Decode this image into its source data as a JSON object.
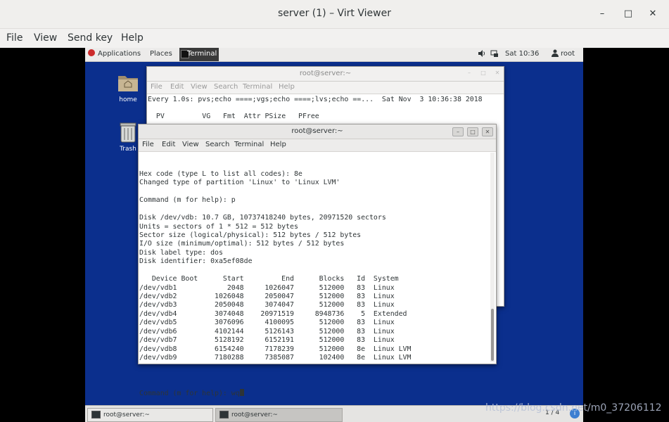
{
  "window": {
    "title": "server (1) – Virt Viewer",
    "minimize": "–",
    "maximize": "□",
    "close": "✕"
  },
  "menu": {
    "file": "File",
    "view": "View",
    "send_key": "Send key",
    "help": "Help"
  },
  "guest_topbar": {
    "applications": "Applications",
    "places": "Places",
    "terminal": "Terminal",
    "clock": "Sat 10:36",
    "user": "root"
  },
  "desktop": {
    "home": "home",
    "trash": "Trash"
  },
  "bg_terminal": {
    "title": "root@server:~",
    "menu": [
      "File",
      "Edit",
      "View",
      "Search",
      "Terminal",
      "Help"
    ],
    "line1": "Every 1.0s: pvs;echo ====;vgs;echo ====;lvs;echo ==...  Sat Nov  3 10:36:38 2018",
    "line2": "",
    "line3": "  PV         VG   Fmt  Attr PSize   PFree"
  },
  "fg_terminal": {
    "title": "root@server:~",
    "menu": [
      "File",
      "Edit",
      "View",
      "Search",
      "Terminal",
      "Help"
    ],
    "lines": [
      "Hex code (type L to list all codes): 8e",
      "Changed type of partition 'Linux' to 'Linux LVM'",
      "",
      "Command (m for help): p",
      "",
      "Disk /dev/vdb: 10.7 GB, 10737418240 bytes, 20971520 sectors",
      "Units = sectors of 1 * 512 = 512 bytes",
      "Sector size (logical/physical): 512 bytes / 512 bytes",
      "I/O size (minimum/optimal): 512 bytes / 512 bytes",
      "Disk label type: dos",
      "Disk identifier: 0xa5ef08de",
      "",
      "   Device Boot      Start         End      Blocks   Id  System",
      "/dev/vdb1            2048     1026047      512000   83  Linux",
      "/dev/vdb2         1026048     2050047      512000   83  Linux",
      "/dev/vdb3         2050048     3074047      512000   83  Linux",
      "/dev/vdb4         3074048    20971519     8948736    5  Extended",
      "/dev/vdb5         3076096     4100095      512000   83  Linux",
      "/dev/vdb6         4102144     5126143      512000   83  Linux",
      "/dev/vdb7         5128192     6152191      512000   83  Linux",
      "/dev/vdb8         6154240     7178239      512000   8e  Linux LVM",
      "/dev/vdb9         7180288     7385087      102400   8e  Linux LVM",
      ""
    ],
    "prompt": "Command (m for help): wq"
  },
  "taskbar": {
    "task1": "root@server:~",
    "task2": "root@server:~",
    "workspace": "1 / 4"
  },
  "watermark": "https://blog.csdn.net/m0_37206112"
}
